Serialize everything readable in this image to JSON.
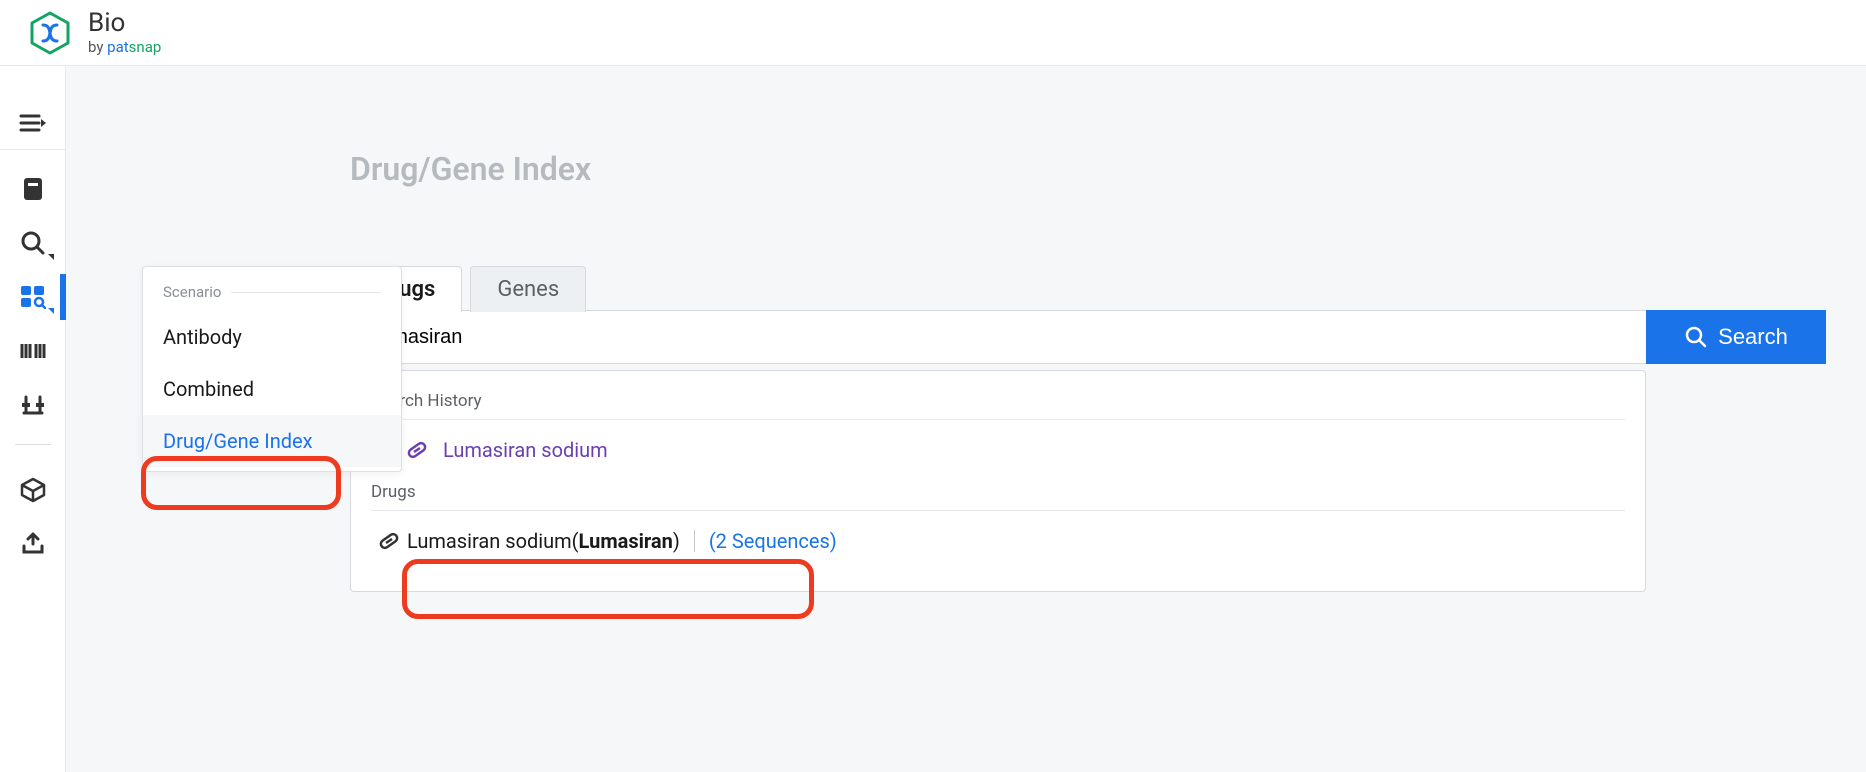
{
  "brand": {
    "title": "Bio",
    "byline_prefix": "by ",
    "byline_pat": "pat",
    "byline_snap": "snap"
  },
  "page_title": "Drug/Gene Index",
  "dropdown": {
    "header": "Scenario",
    "items": [
      {
        "label": "Antibody"
      },
      {
        "label": "Combined"
      },
      {
        "label": "Drug/Gene Index",
        "selected": true
      }
    ]
  },
  "tabs": [
    {
      "label": "Drugs",
      "active": true
    },
    {
      "label": "Genes"
    }
  ],
  "search": {
    "value": "Lumasiran",
    "button": "Search"
  },
  "results": {
    "history_label": "Search History",
    "history_item": "Lumasiran sodium",
    "drugs_label": "Drugs",
    "drug_item_prefix": "Lumasiran sodium(",
    "drug_item_bold": "Lumasiran",
    "drug_item_suffix": ")",
    "sequences_link": "(2 Sequences)"
  },
  "colors": {
    "accent": "#1a73e8",
    "highlight": "#ee3b1f",
    "purple": "#6b3fb0"
  }
}
